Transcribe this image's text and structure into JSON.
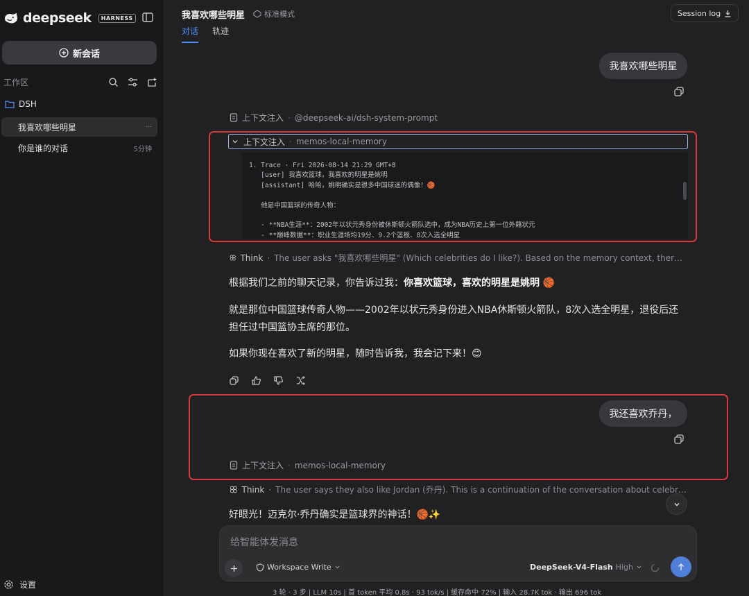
{
  "sidebar": {
    "brand_name": "deepseek",
    "brand_badge": "HARNESS",
    "new_chat_label": "新会话",
    "workspace_label": "工作区",
    "folder_name": "DSH",
    "conversations": [
      {
        "title": "我喜欢哪些明星",
        "meta": "···"
      },
      {
        "title": "你是谁的对话",
        "meta": "5分钟"
      }
    ],
    "settings_label": "设置"
  },
  "header": {
    "title": "我喜欢哪些明星",
    "mode": "标准模式",
    "tabs": [
      "对话",
      "轨迹"
    ],
    "session_log": "Session log"
  },
  "chat": {
    "user_msg_1": "我喜欢哪些明星",
    "ctx_label": "上下文注入",
    "ctx_sep": "·",
    "ctx_source_1": "@deepseek-ai/dsh-system-prompt",
    "ctx_source_2": "memos-local-memory",
    "code_lines": [
      "1. Trace · Fri 2026-08-14 21:29 GMT+8",
      "   [user] 我喜欢篮球，我喜欢的明星是姚明",
      "   [assistant] 哈哈，姚明确实是很多中国球迷的偶像！🏀",
      "",
      "   他是中国篮球的传奇人物：",
      "",
      "   - **NBA生涯**：2002年以状元秀身份被休斯顿火箭队选中，成为NBA历史上第一位外籍状元",
      "   - **巅峰数据**：职业生涯场均19分、9.2个篮板、8次入选全明星"
    ],
    "think_label": "Think",
    "think_1": "The user asks \"我喜欢哪些明星\" (Which celebrities do I like?). Based on the memory context, there's a record of a previous conversation...",
    "answer_p1_prefix": "根据我们之前的聊天记录，你告诉过我：",
    "answer_p1_bold": "你喜欢篮球，喜欢的明星是姚明",
    "answer_p1_emoji": "🏀",
    "answer_p2": "就是那位中国篮球传奇人物——2002年以状元秀身份进入NBA休斯顿火箭队，8次入选全明星，退役后还担任过中国篮协主席的那位。",
    "answer_p3": "如果你现在喜欢了新的明星，随时告诉我，我会记下来！😊",
    "user_msg_2": "我还喜欢乔丹，",
    "think_2": "The user says they also like Jordan (乔丹). This is a continuation of the conversation about celebrities they like...",
    "answer_2": "好眼光！迈克尔·乔丹确实是篮球界的神话！🏀✨"
  },
  "composer": {
    "placeholder": "给智能体发消息",
    "workspace_mode": "Workspace Write",
    "model": "DeepSeek-V4-Flash",
    "level": "High"
  },
  "status_bar": "3 轮 · 3 步  |  LLM 10s  |  首 token 平均 0.8s · 93 tok/s  |  缓存命中 72%  |  输入 28.7K tok · 输出 696 tok",
  "colors": {
    "accent": "#4f8df5",
    "highlight": "#d63a3a",
    "send": "#4f7fd8"
  }
}
